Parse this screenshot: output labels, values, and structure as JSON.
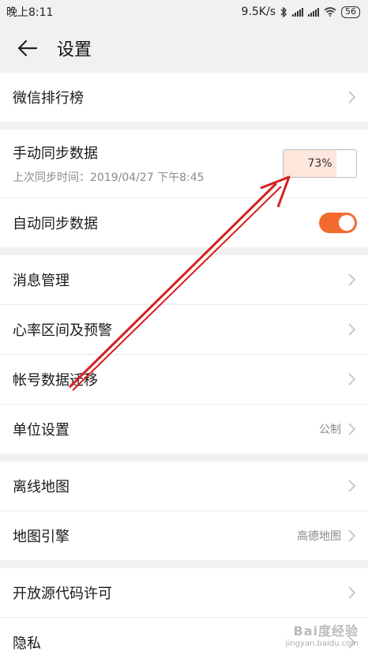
{
  "statusbar": {
    "time": "晚上8:11",
    "speed": "9.5K/s",
    "battery": "56"
  },
  "header": {
    "title": "设置"
  },
  "groups": [
    {
      "items": [
        {
          "label": "微信排行榜"
        }
      ]
    },
    {
      "items": [
        {
          "label": "手动同步数据",
          "sub": "上次同步时间：2019/04/27 下午8:45",
          "progress_text": "73%",
          "progress": 0.73
        },
        {
          "label": "自动同步数据",
          "toggle_on": true
        }
      ]
    },
    {
      "items": [
        {
          "label": "消息管理"
        },
        {
          "label": "心率区间及预警"
        },
        {
          "label": "帐号数据迁移"
        },
        {
          "label": "单位设置",
          "value": "公制"
        }
      ]
    },
    {
      "items": [
        {
          "label": "离线地图"
        },
        {
          "label": "地图引擎",
          "value": "高德地图"
        }
      ]
    },
    {
      "items": [
        {
          "label": "开放源代码许可"
        },
        {
          "label": "隐私"
        }
      ]
    }
  ],
  "watermark": {
    "main": "Bai度经验",
    "sub": "jingyan.baidu.com"
  },
  "colors": {
    "accent": "#f26a2e",
    "annotation": "#d42020",
    "progress_fill": "#fde6dc"
  },
  "icons": {
    "back": "arrow-left-icon",
    "chevron": "chevron-right-icon",
    "bluetooth": "bluetooth-icon",
    "wifi": "wifi-icon"
  }
}
